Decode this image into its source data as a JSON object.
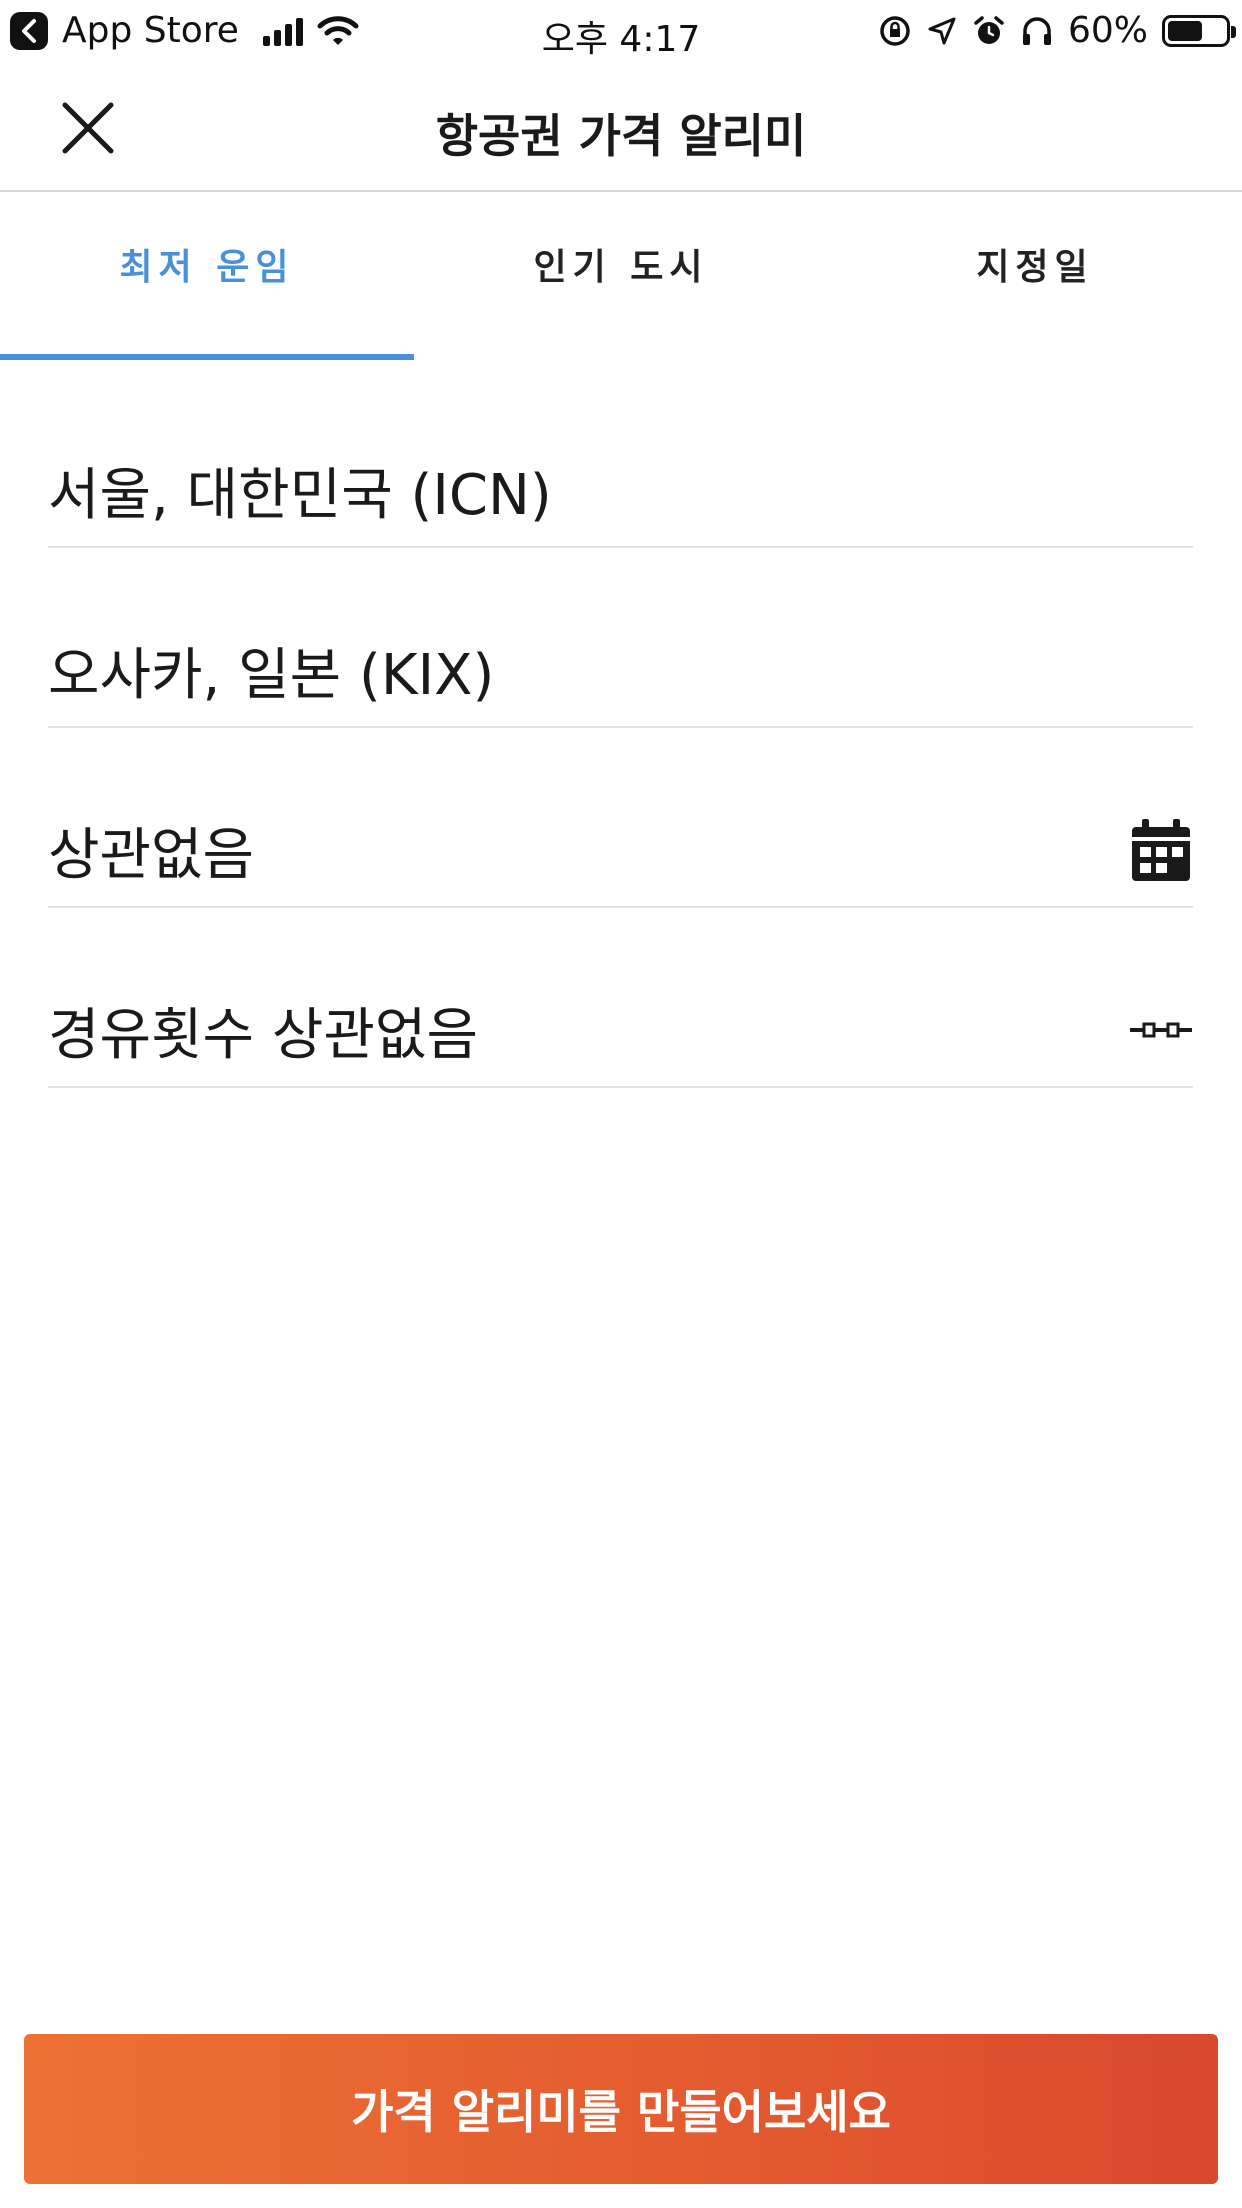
{
  "status_bar": {
    "back_app": "App Store",
    "time": "오후 4:17",
    "battery": "60%",
    "battery_level": 0.6
  },
  "header": {
    "title": "항공권 가격 알리미",
    "close_icon": "close-icon"
  },
  "tabs": [
    {
      "label": "최저 운임",
      "active": true
    },
    {
      "label": "인기 도시",
      "active": false
    },
    {
      "label": "지정일",
      "active": false
    }
  ],
  "form": {
    "origin": "서울, 대한민국 (ICN)",
    "destination": "오사카, 일본 (KIX)",
    "date": "상관없음",
    "date_icon": "calendar-icon",
    "stops": "경유횟수 상관없음",
    "stops_icon": "route-stops-icon"
  },
  "cta": {
    "label": "가격 알리미를 만들어보세요"
  },
  "colors": {
    "accent": "#4a90d9",
    "cta_start": "#ec7133",
    "cta_end": "#d9492d"
  }
}
